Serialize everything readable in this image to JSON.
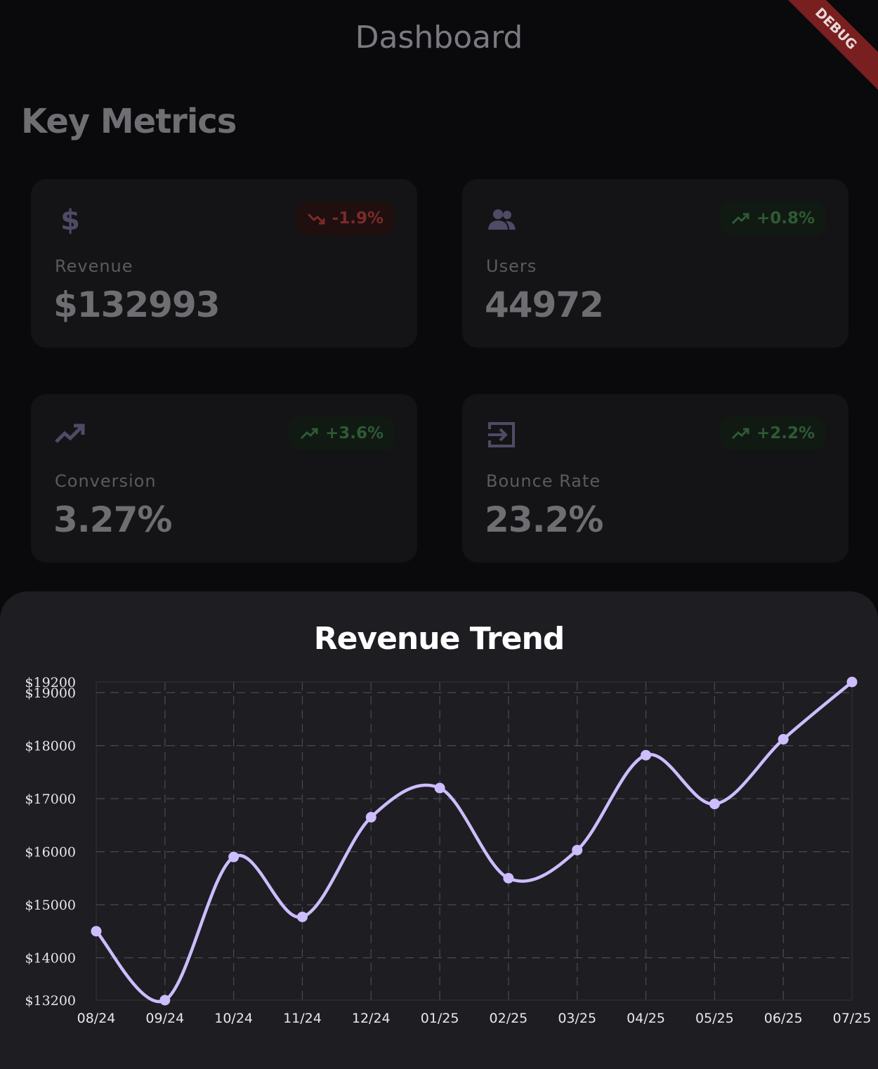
{
  "app_bar": {
    "title": "Dashboard",
    "debug_label": "DEBUG"
  },
  "section": {
    "title": "Key Metrics"
  },
  "metrics": [
    {
      "label": "Revenue",
      "value": "$132993",
      "change": "-1.9%",
      "trend": "down",
      "icon": "dollar-icon"
    },
    {
      "label": "Users",
      "value": "44972",
      "change": "+0.8%",
      "trend": "up",
      "icon": "people-icon"
    },
    {
      "label": "Conversion",
      "value": "3.27%",
      "change": "+3.6%",
      "trend": "up",
      "icon": "trending-up-icon"
    },
    {
      "label": "Bounce Rate",
      "value": "23.2%",
      "change": "+2.2%",
      "trend": "up",
      "icon": "exit-icon"
    }
  ],
  "colors": {
    "line": "#cdbdff",
    "down_badge": "#7a2b2b",
    "up_badge": "#2f5a34",
    "icon": "#4f4b66"
  },
  "chart_data": {
    "type": "line",
    "title": "Revenue Trend",
    "xlabel": "",
    "ylabel": "",
    "categories": [
      "08/24",
      "09/24",
      "10/24",
      "11/24",
      "12/24",
      "01/25",
      "02/25",
      "03/25",
      "04/25",
      "05/25",
      "06/25",
      "07/25"
    ],
    "series": [
      {
        "values": [
          14500,
          13200,
          15900,
          14770,
          16650,
          17200,
          15500,
          16030,
          17820,
          16900,
          18120,
          19200
        ]
      }
    ],
    "ylim": [
      13200,
      19200
    ],
    "yticks": [
      13200,
      14000,
      15000,
      16000,
      17000,
      18000,
      19000,
      19200
    ],
    "ytick_labels": [
      "$13200",
      "$14000",
      "$15000",
      "$16000",
      "$17000",
      "$18000",
      "$19000",
      "$19200"
    ],
    "grid": true,
    "curve": "smooth"
  }
}
